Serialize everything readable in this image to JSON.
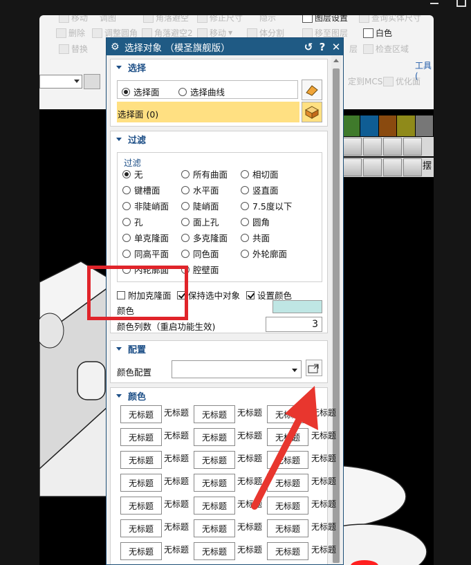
{
  "dialog": {
    "title": "选择对象 （模圣旗舰版）",
    "buttons": {
      "reset": "↺",
      "help": "?",
      "close": "✕"
    }
  },
  "select_section": {
    "header": "选择",
    "options": [
      {
        "label": "选择面",
        "selected": true
      },
      {
        "label": "选择曲线",
        "selected": false
      }
    ],
    "status": "选择面 (0)"
  },
  "filter_section": {
    "header": "过滤",
    "group_label": "过滤",
    "options": [
      {
        "label": "无",
        "selected": true
      },
      {
        "label": "所有曲面",
        "selected": false
      },
      {
        "label": "相切面",
        "selected": false
      },
      {
        "label": "键槽面",
        "selected": false
      },
      {
        "label": "水平面",
        "selected": false
      },
      {
        "label": "竖直面",
        "selected": false
      },
      {
        "label": "非陡峭面",
        "selected": false
      },
      {
        "label": "陡峭面",
        "selected": false
      },
      {
        "label": "7.5度以下",
        "selected": false
      },
      {
        "label": "孔",
        "selected": false
      },
      {
        "label": "面上孔",
        "selected": false
      },
      {
        "label": "圆角",
        "selected": false
      },
      {
        "label": "单克隆面",
        "selected": false
      },
      {
        "label": "多克隆面",
        "selected": false
      },
      {
        "label": "共面",
        "selected": false
      },
      {
        "label": "同高平面",
        "selected": false
      },
      {
        "label": "同色面",
        "selected": false
      },
      {
        "label": "外轮廓面",
        "selected": false
      },
      {
        "label": "内轮廓面",
        "selected": false
      },
      {
        "label": "腔壁面",
        "selected": false
      }
    ],
    "checkboxes": [
      {
        "label": "附加克隆面",
        "checked": false
      },
      {
        "label": "保持选中对象",
        "checked": true
      },
      {
        "label": "设置颜色",
        "checked": true
      }
    ],
    "color_label": "颜色",
    "color_value": "#bfe6e4",
    "color_count_label": "颜色列数（重启功能生效)",
    "color_count_value": "3"
  },
  "config_section": {
    "header": "配置",
    "color_config_label": "颜色配置",
    "color_config_value": ""
  },
  "color_section": {
    "header": "颜色",
    "untitled": "无标题"
  },
  "background_app": {
    "ribbon_items": [
      "移动",
      "调图",
      "角落避空",
      "修正尺寸",
      "隐示",
      "图层设置",
      "查询实体尺寸",
      "删除",
      "调整圆角",
      "角落避空2",
      "移动",
      "体分割",
      "移至图层",
      "白色",
      "替换",
      "检查区域",
      "定到MCS",
      "优化面",
      "层"
    ],
    "tools_label": "工具(",
    "toolbar_label": "摆",
    "swatch_colors": [
      "#3f7a2b",
      "#0f5d94",
      "#8a4a0f",
      "#8f8a1a",
      "#777777"
    ]
  },
  "accent_colors": {
    "title_bar": "#1f5a84",
    "highlight": "#ffe082",
    "annotation": "#e0242a"
  }
}
